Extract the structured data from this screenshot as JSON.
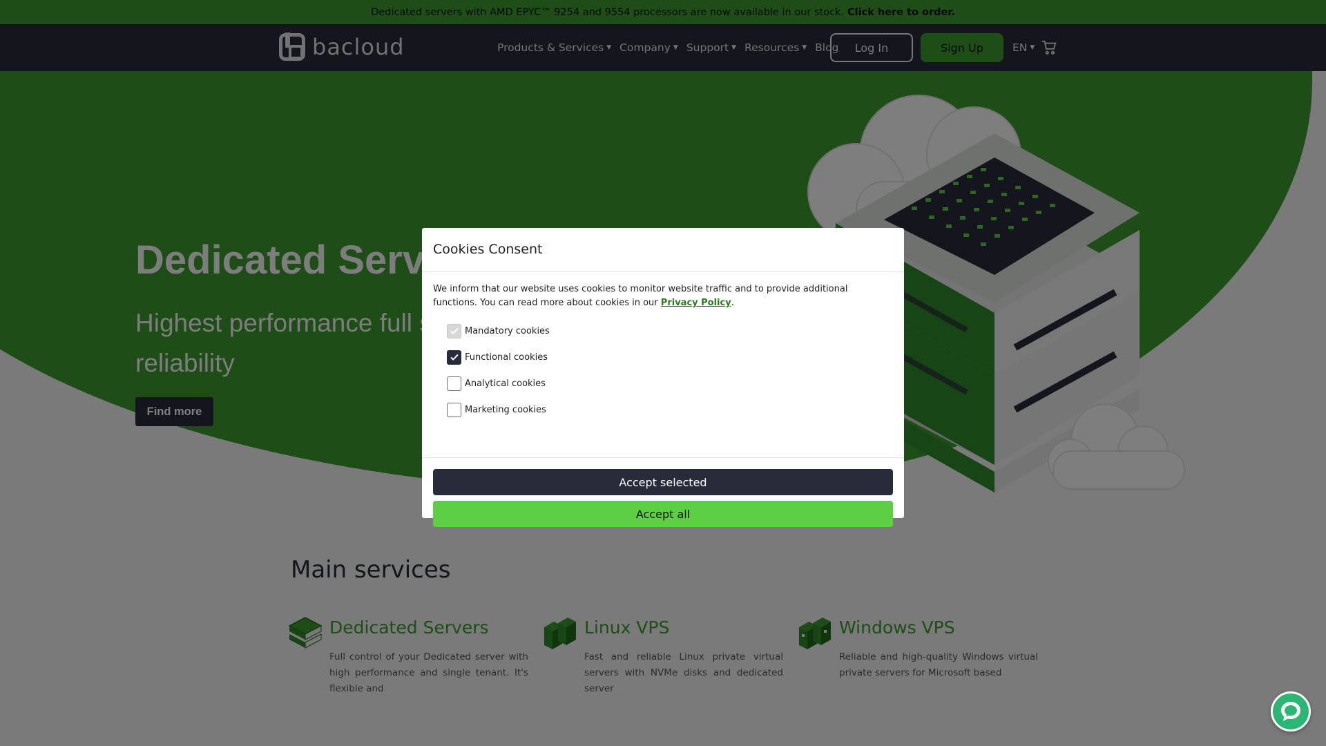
{
  "announcement": {
    "text": "Dedicated servers with AMD EPYC™ 9254 and 9554 processors are now available in our stock.",
    "link": "Click here to order."
  },
  "nav": {
    "logo_text": "bacloud",
    "links": [
      "Products & Services",
      "Company",
      "Support",
      "Resources",
      "Blog"
    ],
    "login": "Log In",
    "signup": "Sign Up",
    "lang": "EN"
  },
  "hero": {
    "title": "Dedicated Servers",
    "subtitle": "Highest performance full servers for TOP reliability",
    "cta": "Find more"
  },
  "services": {
    "title": "Main services",
    "items": [
      {
        "name": "Dedicated Servers",
        "desc": "Full control of your Dedicated server with high performance and single tenant. It's flexible and"
      },
      {
        "name": "Linux VPS",
        "desc": "Fast and reliable Linux private virtual servers with NVMe disks and dedicated server"
      },
      {
        "name": "Windows VPS",
        "desc": "Reliable and high-quality Windows virtual private servers for Microsoft based"
      }
    ]
  },
  "cookies": {
    "title": "Cookies Consent",
    "text_before": "We inform that our website uses cookies to monitor website traffic and to provide additional functions. You can read more about cookies in our",
    "privacy_link": "Privacy Policy",
    "text_after": ".",
    "options": [
      {
        "label": "Mandatory cookies",
        "checked": true,
        "disabled": true
      },
      {
        "label": "Functional cookies",
        "checked": true,
        "disabled": false
      },
      {
        "label": "Analytical cookies",
        "checked": false,
        "disabled": false
      },
      {
        "label": "Marketing cookies",
        "checked": false,
        "disabled": false
      }
    ],
    "accept_selected": "Accept selected",
    "accept_all": "Accept all"
  },
  "colors": {
    "brand_green": "#3c9a2e",
    "dark": "#282b3a",
    "accept_all": "#5dcf45"
  }
}
